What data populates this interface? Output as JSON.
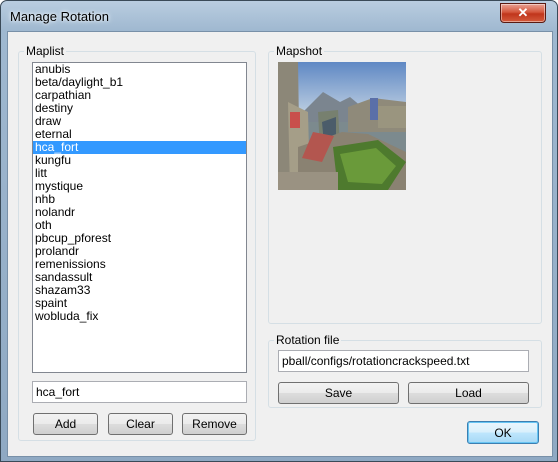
{
  "window": {
    "title": "Manage Rotation",
    "close_glyph": "✕"
  },
  "maplist": {
    "legend": "Maplist",
    "items": [
      "anubis",
      "beta/daylight_b1",
      "carpathian",
      "destiny",
      "draw",
      "eternal",
      "hca_fort",
      "kungfu",
      "litt",
      "mystique",
      "nhb",
      "nolandr",
      "oth",
      "pbcup_pforest",
      "prolandr",
      "remenissions",
      "sandassult",
      "shazam33",
      "spaint",
      "wobluda_fix"
    ],
    "selected_index": 6,
    "name_value": "hca_fort",
    "add_label": "Add",
    "clear_label": "Clear",
    "remove_label": "Remove"
  },
  "mapshot": {
    "legend": "Mapshot"
  },
  "rotation": {
    "legend": "Rotation file",
    "path_value": "pball/configs/rotationcrackspeed.txt",
    "save_label": "Save",
    "load_label": "Load"
  },
  "ok_label": "OK",
  "colors": {
    "selection": "#3399ff",
    "close_button": "#c0351b"
  }
}
